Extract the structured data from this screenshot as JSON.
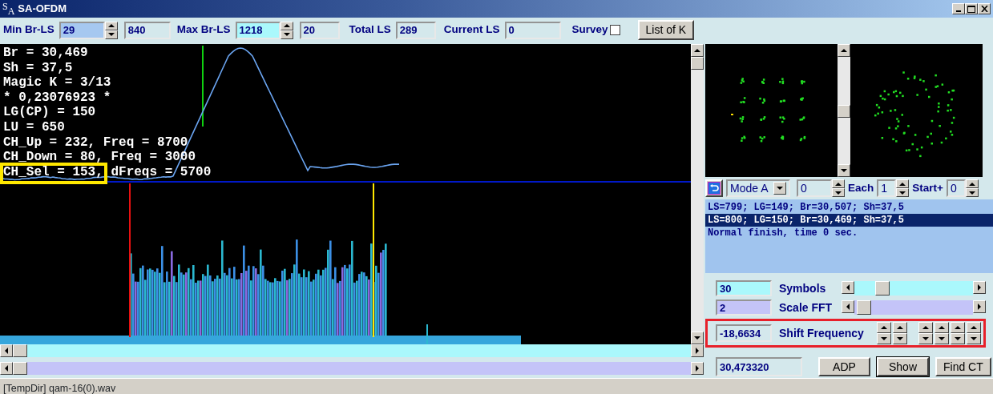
{
  "window": {
    "title": "SA-OFDM",
    "logo": [
      "S",
      "A"
    ]
  },
  "toolbar": {
    "min_br_ls": {
      "label": "Min Br-LS",
      "value": "29",
      "extra": "840"
    },
    "max_br_ls": {
      "label": "Max Br-LS",
      "value": "1218",
      "extra": "20"
    },
    "total_ls": {
      "label": "Total LS",
      "value": "289"
    },
    "current_ls": {
      "label": "Current LS",
      "value": "0"
    },
    "survey": {
      "label": "Survey",
      "checked": false
    },
    "list_button": "List of K"
  },
  "plot": {
    "info_lines": [
      {
        "text": "Br = 30,469",
        "highlighted": false
      },
      {
        "text": "Sh = 37,5",
        "highlighted": false
      },
      {
        "text": "Magic K = 3/13",
        "highlighted": false
      },
      {
        "text": "* 0,23076923 *",
        "highlighted": false
      },
      {
        "text": "LG(CP) = 150",
        "highlighted": false
      },
      {
        "text": "LU = 650",
        "highlighted": false
      },
      {
        "text": "CH_Up = 232, Freq = 8700",
        "highlighted": false
      },
      {
        "text": "CH_Down = 80, Freq = 3000",
        "highlighted": false
      },
      {
        "text": "CH_Sel = 153, dFreqs = 5700",
        "highlighted": true
      }
    ]
  },
  "mode_bar": {
    "mode": "Mode A",
    "value": "0",
    "each_label": "Each",
    "each_value": "1",
    "start_label": "Start+",
    "start_value": "0"
  },
  "log": [
    {
      "text": "LS=799; LG=149; Br=30,507; Sh=37,5",
      "selected": false
    },
    {
      "text": "LS=800; LG=150; Br=30,469; Sh=37,5",
      "selected": true
    },
    {
      "text": "Normal finish, time 0 sec.",
      "selected": false
    }
  ],
  "symbols": {
    "value": "30",
    "label": "Symbols",
    "level": 0.2
  },
  "scale_fft": {
    "value": "2",
    "label": "Scale FFT",
    "level": 0.02
  },
  "shift": {
    "value": "-18,6634",
    "label": "Shift Frequency",
    "highlighted": true
  },
  "result": {
    "value": "30,473320"
  },
  "buttons": [
    {
      "label": "ADP",
      "default": false
    },
    {
      "label": "Show",
      "default": true
    },
    {
      "label": "Find CT",
      "default": false
    }
  ],
  "status_bar": "[TempDir] qam-16(0).wav"
}
